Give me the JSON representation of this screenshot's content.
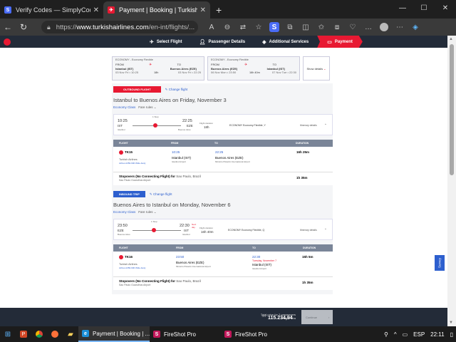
{
  "browser": {
    "tabs": [
      {
        "title": "Verify Codes — SimplyCodes",
        "active": false
      },
      {
        "title": "Payment | Booking | Turkish Airlines",
        "active": true
      }
    ],
    "url_prefix": "https://",
    "url_host": "www.turkishairlines.com",
    "url_path": "/en-int/flights/...",
    "accent_color": "#e81932"
  },
  "site": {
    "steps": [
      {
        "label": "Select Flight",
        "icon": "plane-icon"
      },
      {
        "label": "Passenger Details",
        "icon": "person-icon"
      },
      {
        "label": "Additional Services",
        "icon": "luggage-icon"
      },
      {
        "label": "Payment",
        "icon": "card-icon",
        "active": true
      }
    ]
  },
  "summary": {
    "cards": [
      {
        "fare": "ECONOMY - Economy Flexible",
        "from_label": "FROM",
        "to_label": "TO",
        "from": "Istanbul (IST)",
        "to": "Buenos Aires (EZE)",
        "from_date": "03 Nov Fri  •  10:25",
        "to_date": "03 Nov Fri  •  22:25",
        "duration": "18h"
      },
      {
        "fare": "ECONOMY - Economy Flexible",
        "from_label": "FROM",
        "to_label": "TO",
        "from": "Buenos Aires (EZE)",
        "to": "Istanbul (IST)",
        "from_date": "06 Nov Mon  •  23:50",
        "to_date": "07 Nov Tue  •  22:30",
        "duration": "16h 40m"
      }
    ],
    "show_details": "Show details"
  },
  "outbound": {
    "tag": "OUTBOUND FLIGHT",
    "change": "Change flight",
    "title": "Istanbul to Buenos Aires on Friday, November 3",
    "fare_class": "Economy Class",
    "fare_rules": "Fare rules",
    "dep_time": "10:25",
    "dep_code": "IST",
    "dep_city": "Istanbul",
    "arr_time": "22:25",
    "arr_code": "EZE",
    "arr_city": "Buenos Aires",
    "stop_label": "1 Stop",
    "duration_label": "Flight duration",
    "duration": "18h",
    "fare_name": "ECONOMY  Economy Flexible, Y",
    "itinerary": "Itinerary details",
    "headers": [
      "FLIGHT",
      "FROM",
      "TO",
      "DURATION"
    ],
    "flight_no": "TK15",
    "airline": "Turkish Airlines",
    "aircraft": "Airbus A350-900 Wide-body",
    "from_time": "10:25",
    "from_name": "Istanbul (IST)",
    "from_airport": "Istanbul Airport",
    "to_time": "22:25",
    "to_name": "Buenos Aires (EZE)",
    "to_airport": "Ministro Pistarini International Airport",
    "row_duration": "16h 25m",
    "stopover_title": "Stopovers (No Connecting Flight) for",
    "stopover_city": "Sao Paulo, Brazil",
    "stopover_airport": "Sao Paulo Guarulhos Airport",
    "stopover_duration": "1h 35m"
  },
  "inbound": {
    "tag": "INBOUND TRIP",
    "change": "Change flight",
    "title": "Buenos Aires to Istanbul on Monday, November 6",
    "fare_class": "Economy Class",
    "fare_rules": "Fare rules",
    "dep_time": "23:50",
    "dep_code": "EZE",
    "dep_city": "Buenos Aires",
    "arr_time": "22:30",
    "arr_code": "IST",
    "arr_city": "Istanbul",
    "next_day": "Next day",
    "stop_label": "1 Stop",
    "duration_label": "Flight duration",
    "duration": "16h 40m",
    "fare_name": "ECONOMY  Economy Flexible, Q",
    "itinerary": "Itinerary details",
    "headers": [
      "FLIGHT",
      "FROM",
      "TO",
      "DURATION"
    ],
    "flight_no": "TK16",
    "airline": "Turkish Airlines",
    "aircraft": "Airbus A350-900 Wide-body",
    "from_time": "23:50",
    "from_name": "Buenos Aires (EZE)",
    "from_airport": "Ministro Pistarini International Airport",
    "to_time": "22:30",
    "to_date": "Tuesday, November 7",
    "to_name": "Istanbul (IST)",
    "to_airport": "Istanbul Airport",
    "row_duration": "15h 5m",
    "stopover_title": "Stopovers (No Connecting Flight) for",
    "stopover_city": "Sao Paulo, Brazil",
    "stopover_airport": "Sao Paulo Guarulhos Airport",
    "stopover_duration": "1h 35m"
  },
  "price": {
    "label_line1": "Total price for 2 passengers",
    "label_line2": "Turkish Lira",
    "currency": "TRY",
    "amount": "115.234,94",
    "continue": "Continue"
  },
  "survey": "Survey",
  "taskbar": {
    "apps": [
      {
        "label": "Payment | Booking | ...",
        "active": true,
        "icon": "edge-icon"
      },
      {
        "label": "FireShot Pro",
        "active": false,
        "icon": "fireshot-icon"
      },
      {
        "label": "FireShot Pro",
        "active": false,
        "icon": "fireshot-icon"
      }
    ],
    "lang": "ESP",
    "time": "22:11"
  }
}
